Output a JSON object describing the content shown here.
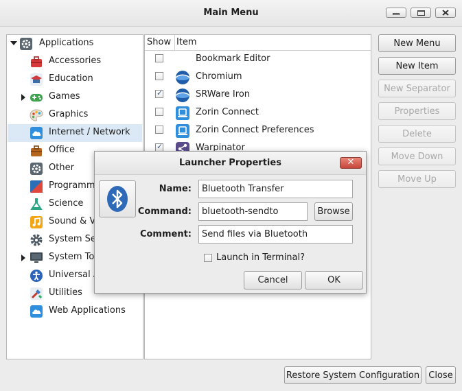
{
  "window": {
    "title": "Main Menu"
  },
  "tree": {
    "root_label": "Applications",
    "items": [
      {
        "label": "Accessories",
        "icon": "toolbox-icon"
      },
      {
        "label": "Education",
        "icon": "education-icon"
      },
      {
        "label": "Games",
        "icon": "gamepad-icon"
      },
      {
        "label": "Graphics",
        "icon": "palette-icon"
      },
      {
        "label": "Internet / Network",
        "icon": "cloud-icon"
      },
      {
        "label": "Office",
        "icon": "briefcase-icon"
      },
      {
        "label": "Other",
        "icon": "gear-icon"
      },
      {
        "label": "Programm",
        "icon": "code-icon"
      },
      {
        "label": "Science",
        "icon": "flask-icon"
      },
      {
        "label": "Sound & V",
        "icon": "music-icon"
      },
      {
        "label": "System Se",
        "icon": "gear-icon"
      },
      {
        "label": "System To",
        "icon": "monitor-icon"
      },
      {
        "label": "Universal A",
        "icon": "accessibility-icon"
      },
      {
        "label": "Utilities",
        "icon": "tools-icon"
      },
      {
        "label": "Web Applications",
        "icon": "cloud-icon"
      }
    ]
  },
  "items_list": {
    "header_show": "Show",
    "header_item": "Item",
    "rows": [
      {
        "label": "Bookmark Editor",
        "checked": false,
        "icon": ""
      },
      {
        "label": "Chromium",
        "checked": false,
        "icon": "globe-icon"
      },
      {
        "label": "SRWare Iron",
        "checked": true,
        "icon": "globe-icon"
      },
      {
        "label": "Zorin Connect",
        "checked": false,
        "icon": "phone-connect-icon"
      },
      {
        "label": "Zorin Connect Preferences",
        "checked": false,
        "icon": "phone-connect-icon"
      },
      {
        "label": "Warpinator",
        "checked": true,
        "icon": "share-icon"
      }
    ]
  },
  "side_buttons": {
    "new_menu": "New Menu",
    "new_item": "New Item",
    "new_separator": "New Separator",
    "properties": "Properties",
    "delete": "Delete",
    "move_down": "Move Down",
    "move_up": "Move Up"
  },
  "footer": {
    "restore": "Restore System Configuration",
    "close": "Close"
  },
  "dialog": {
    "title": "Launcher Properties",
    "close_glyph": "✕",
    "icon": "bluetooth-icon",
    "name_label": "Name:",
    "name_value": "Bluetooth Transfer",
    "command_label": "Command:",
    "command_value": "bluetooth-sendto",
    "browse_label": "Browse",
    "comment_label": "Comment:",
    "comment_value": "Send files via Bluetooth",
    "terminal_label": "Launch in Terminal?",
    "terminal_checked": false,
    "cancel_label": "Cancel",
    "ok_label": "OK"
  }
}
